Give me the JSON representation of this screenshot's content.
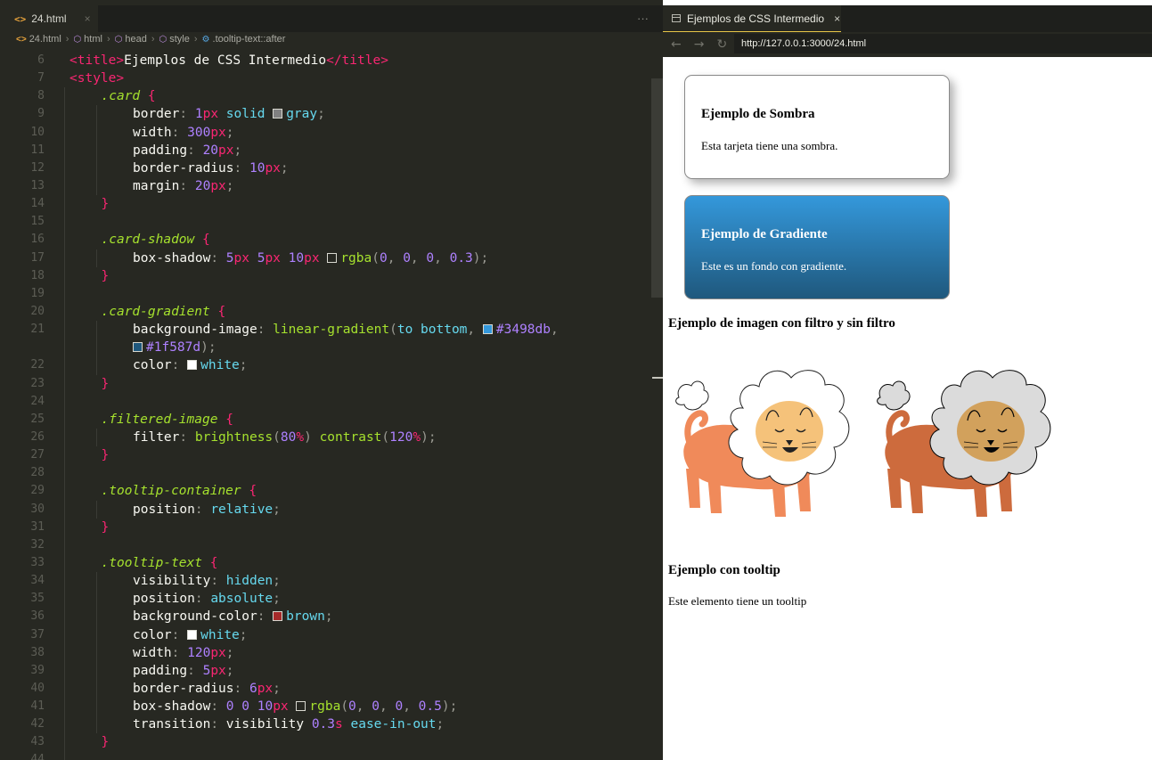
{
  "editor": {
    "tab_label": "24.html",
    "tab_icon": "html-file-icon",
    "tab_close": "×",
    "more": "···",
    "breadcrumb": [
      "24.html",
      "html",
      "head",
      "style",
      ".tooltip-text::after"
    ]
  },
  "code_lines": [
    {
      "n": "6",
      "indent": 1,
      "parts": [
        [
          "tag",
          "<title>"
        ],
        [
          "prop",
          "Ejemplos de CSS Intermedio"
        ],
        [
          "tag",
          "</title>"
        ]
      ]
    },
    {
      "n": "7",
      "indent": 1,
      "parts": [
        [
          "tag",
          "<style>"
        ]
      ]
    },
    {
      "n": "8",
      "indent": 2,
      "parts": [
        [
          "sel",
          ".card"
        ],
        [
          "prop",
          " "
        ],
        [
          "brace",
          "{"
        ]
      ]
    },
    {
      "n": "9",
      "indent": 3,
      "parts": [
        [
          "prop",
          "border"
        ],
        [
          "punct",
          ": "
        ],
        [
          "num",
          "1"
        ],
        [
          "unit",
          "px"
        ],
        [
          "prop",
          " "
        ],
        [
          "kw",
          "solid"
        ],
        [
          "prop",
          " "
        ],
        [
          "swatch",
          "#808080"
        ],
        [
          "kw",
          "gray"
        ],
        [
          "punct",
          ";"
        ]
      ]
    },
    {
      "n": "10",
      "indent": 3,
      "parts": [
        [
          "prop",
          "width"
        ],
        [
          "punct",
          ": "
        ],
        [
          "num",
          "300"
        ],
        [
          "unit",
          "px"
        ],
        [
          "punct",
          ";"
        ]
      ]
    },
    {
      "n": "11",
      "indent": 3,
      "parts": [
        [
          "prop",
          "padding"
        ],
        [
          "punct",
          ": "
        ],
        [
          "num",
          "20"
        ],
        [
          "unit",
          "px"
        ],
        [
          "punct",
          ";"
        ]
      ]
    },
    {
      "n": "12",
      "indent": 3,
      "parts": [
        [
          "prop",
          "border-radius"
        ],
        [
          "punct",
          ": "
        ],
        [
          "num",
          "10"
        ],
        [
          "unit",
          "px"
        ],
        [
          "punct",
          ";"
        ]
      ]
    },
    {
      "n": "13",
      "indent": 3,
      "parts": [
        [
          "prop",
          "margin"
        ],
        [
          "punct",
          ": "
        ],
        [
          "num",
          "20"
        ],
        [
          "unit",
          "px"
        ],
        [
          "punct",
          ";"
        ]
      ]
    },
    {
      "n": "14",
      "indent": 2,
      "parts": [
        [
          "brace",
          "}"
        ]
      ]
    },
    {
      "n": "15",
      "indent": 2,
      "parts": []
    },
    {
      "n": "16",
      "indent": 2,
      "parts": [
        [
          "sel",
          ".card-shadow"
        ],
        [
          "prop",
          " "
        ],
        [
          "brace",
          "{"
        ]
      ]
    },
    {
      "n": "17",
      "indent": 3,
      "parts": [
        [
          "prop",
          "box-shadow"
        ],
        [
          "punct",
          ": "
        ],
        [
          "num",
          "5"
        ],
        [
          "unit",
          "px"
        ],
        [
          "prop",
          " "
        ],
        [
          "num",
          "5"
        ],
        [
          "unit",
          "px"
        ],
        [
          "prop",
          " "
        ],
        [
          "num",
          "10"
        ],
        [
          "unit",
          "px"
        ],
        [
          "prop",
          " "
        ],
        [
          "swatch",
          "transparent"
        ],
        [
          "fn",
          "rgba"
        ],
        [
          "punct",
          "("
        ],
        [
          "num",
          "0"
        ],
        [
          "punct",
          ", "
        ],
        [
          "num",
          "0"
        ],
        [
          "punct",
          ", "
        ],
        [
          "num",
          "0"
        ],
        [
          "punct",
          ", "
        ],
        [
          "num",
          "0.3"
        ],
        [
          "punct",
          ");"
        ]
      ]
    },
    {
      "n": "18",
      "indent": 2,
      "parts": [
        [
          "brace",
          "}"
        ]
      ]
    },
    {
      "n": "19",
      "indent": 2,
      "parts": []
    },
    {
      "n": "20",
      "indent": 2,
      "parts": [
        [
          "sel",
          ".card-gradient"
        ],
        [
          "prop",
          " "
        ],
        [
          "brace",
          "{"
        ]
      ]
    },
    {
      "n": "21",
      "indent": 3,
      "parts": [
        [
          "prop",
          "background-image"
        ],
        [
          "punct",
          ": "
        ],
        [
          "fn",
          "linear-gradient"
        ],
        [
          "punct",
          "("
        ],
        [
          "kw",
          "to bottom"
        ],
        [
          "punct",
          ", "
        ],
        [
          "swatch",
          "#3498db"
        ],
        [
          "hex",
          "#3498db"
        ],
        [
          "punct",
          ","
        ]
      ]
    },
    {
      "n": "",
      "indent": 3,
      "parts": [
        [
          "swatch",
          "#1f587d"
        ],
        [
          "hex",
          "#1f587d"
        ],
        [
          "punct",
          ");"
        ]
      ]
    },
    {
      "n": "22",
      "indent": 3,
      "parts": [
        [
          "prop",
          "color"
        ],
        [
          "punct",
          ": "
        ],
        [
          "swatch",
          "#ffffff"
        ],
        [
          "kw",
          "white"
        ],
        [
          "punct",
          ";"
        ]
      ]
    },
    {
      "n": "23",
      "indent": 2,
      "parts": [
        [
          "brace",
          "}"
        ]
      ]
    },
    {
      "n": "24",
      "indent": 2,
      "parts": []
    },
    {
      "n": "25",
      "indent": 2,
      "parts": [
        [
          "sel",
          ".filtered-image"
        ],
        [
          "prop",
          " "
        ],
        [
          "brace",
          "{"
        ]
      ]
    },
    {
      "n": "26",
      "indent": 3,
      "parts": [
        [
          "prop",
          "filter"
        ],
        [
          "punct",
          ": "
        ],
        [
          "fn",
          "brightness"
        ],
        [
          "punct",
          "("
        ],
        [
          "num",
          "80"
        ],
        [
          "unit",
          "%"
        ],
        [
          "punct",
          ") "
        ],
        [
          "fn",
          "contrast"
        ],
        [
          "punct",
          "("
        ],
        [
          "num",
          "120"
        ],
        [
          "unit",
          "%"
        ],
        [
          "punct",
          ");"
        ]
      ]
    },
    {
      "n": "27",
      "indent": 2,
      "parts": [
        [
          "brace",
          "}"
        ]
      ]
    },
    {
      "n": "28",
      "indent": 2,
      "parts": []
    },
    {
      "n": "29",
      "indent": 2,
      "parts": [
        [
          "sel",
          ".tooltip-container"
        ],
        [
          "prop",
          " "
        ],
        [
          "brace",
          "{"
        ]
      ]
    },
    {
      "n": "30",
      "indent": 3,
      "parts": [
        [
          "prop",
          "position"
        ],
        [
          "punct",
          ": "
        ],
        [
          "kw",
          "relative"
        ],
        [
          "punct",
          ";"
        ]
      ]
    },
    {
      "n": "31",
      "indent": 2,
      "parts": [
        [
          "brace",
          "}"
        ]
      ]
    },
    {
      "n": "32",
      "indent": 2,
      "parts": []
    },
    {
      "n": "33",
      "indent": 2,
      "parts": [
        [
          "sel",
          ".tooltip-text"
        ],
        [
          "prop",
          " "
        ],
        [
          "brace",
          "{"
        ]
      ]
    },
    {
      "n": "34",
      "indent": 3,
      "parts": [
        [
          "prop",
          "visibility"
        ],
        [
          "punct",
          ": "
        ],
        [
          "kw",
          "hidden"
        ],
        [
          "punct",
          ";"
        ]
      ]
    },
    {
      "n": "35",
      "indent": 3,
      "parts": [
        [
          "prop",
          "position"
        ],
        [
          "punct",
          ": "
        ],
        [
          "kw",
          "absolute"
        ],
        [
          "punct",
          ";"
        ]
      ]
    },
    {
      "n": "36",
      "indent": 3,
      "parts": [
        [
          "prop",
          "background-color"
        ],
        [
          "punct",
          ": "
        ],
        [
          "swatch",
          "#a52a2a"
        ],
        [
          "kw",
          "brown"
        ],
        [
          "punct",
          ";"
        ]
      ]
    },
    {
      "n": "37",
      "indent": 3,
      "parts": [
        [
          "prop",
          "color"
        ],
        [
          "punct",
          ": "
        ],
        [
          "swatch",
          "#ffffff"
        ],
        [
          "kw",
          "white"
        ],
        [
          "punct",
          ";"
        ]
      ]
    },
    {
      "n": "38",
      "indent": 3,
      "parts": [
        [
          "prop",
          "width"
        ],
        [
          "punct",
          ": "
        ],
        [
          "num",
          "120"
        ],
        [
          "unit",
          "px"
        ],
        [
          "punct",
          ";"
        ]
      ]
    },
    {
      "n": "39",
      "indent": 3,
      "parts": [
        [
          "prop",
          "padding"
        ],
        [
          "punct",
          ": "
        ],
        [
          "num",
          "5"
        ],
        [
          "unit",
          "px"
        ],
        [
          "punct",
          ";"
        ]
      ]
    },
    {
      "n": "40",
      "indent": 3,
      "parts": [
        [
          "prop",
          "border-radius"
        ],
        [
          "punct",
          ": "
        ],
        [
          "num",
          "6"
        ],
        [
          "unit",
          "px"
        ],
        [
          "punct",
          ";"
        ]
      ]
    },
    {
      "n": "41",
      "indent": 3,
      "parts": [
        [
          "prop",
          "box-shadow"
        ],
        [
          "punct",
          ": "
        ],
        [
          "num",
          "0"
        ],
        [
          "prop",
          " "
        ],
        [
          "num",
          "0"
        ],
        [
          "prop",
          " "
        ],
        [
          "num",
          "10"
        ],
        [
          "unit",
          "px"
        ],
        [
          "prop",
          " "
        ],
        [
          "swatch",
          "transparent"
        ],
        [
          "fn",
          "rgba"
        ],
        [
          "punct",
          "("
        ],
        [
          "num",
          "0"
        ],
        [
          "punct",
          ", "
        ],
        [
          "num",
          "0"
        ],
        [
          "punct",
          ", "
        ],
        [
          "num",
          "0"
        ],
        [
          "punct",
          ", "
        ],
        [
          "num",
          "0.5"
        ],
        [
          "punct",
          ");"
        ]
      ]
    },
    {
      "n": "42",
      "indent": 3,
      "parts": [
        [
          "prop",
          "transition"
        ],
        [
          "punct",
          ": "
        ],
        [
          "prop",
          "visibility "
        ],
        [
          "num",
          "0.3"
        ],
        [
          "unit",
          "s"
        ],
        [
          "prop",
          " "
        ],
        [
          "kw",
          "ease-in-out"
        ],
        [
          "punct",
          ";"
        ]
      ]
    },
    {
      "n": "43",
      "indent": 2,
      "parts": [
        [
          "brace",
          "}"
        ]
      ]
    },
    {
      "n": "44",
      "indent": 2,
      "parts": []
    }
  ],
  "browser": {
    "tab_label": "Ejemplos de CSS Intermedio",
    "tab_close": "×",
    "back": "←",
    "forward": "→",
    "reload": "↻",
    "url": "http://127.0.0.1:3000/24.html"
  },
  "page": {
    "shadow_card": {
      "title": "Ejemplo de Sombra",
      "text": "Esta tarjeta tiene una sombra."
    },
    "gradient_card": {
      "title": "Ejemplo de Gradiente",
      "text": "Este es un fondo con gradiente."
    },
    "filter_title": "Ejemplo de imagen con filtro y sin filtro",
    "tooltip_title": "Ejemplo con tooltip",
    "tooltip_text": "Este elemento tiene un tooltip"
  },
  "colors": {
    "accent_tab": "#e7c547",
    "gradient_top": "#3498db",
    "gradient_bottom": "#1f587d",
    "lion_body": "#f08a5a",
    "lion_face": "#f5c27a"
  }
}
